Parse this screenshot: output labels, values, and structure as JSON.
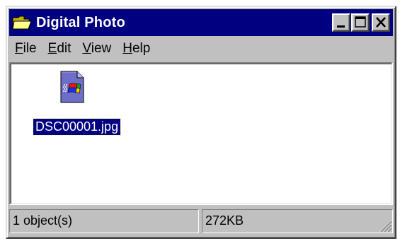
{
  "window": {
    "title": "Digital Photo",
    "title_icon": "folder-open-icon",
    "controls": {
      "minimize_icon": "minimize-icon",
      "maximize_icon": "maximize-icon",
      "close_icon": "close-icon"
    }
  },
  "menu": {
    "items": [
      {
        "label_mnemonic": "F",
        "label_rest": "ile"
      },
      {
        "label_mnemonic": "E",
        "label_rest": "dit"
      },
      {
        "label_mnemonic": "V",
        "label_rest": "iew"
      },
      {
        "label_mnemonic": "H",
        "label_rest": "elp"
      }
    ]
  },
  "files": [
    {
      "name": "DSC00001.jpg",
      "icon": "image-file-icon",
      "selected": true
    }
  ],
  "status": {
    "objects": "1 object(s)",
    "size": "272KB"
  },
  "colors": {
    "title_bar": "#000080",
    "face": "#c0c0c0",
    "selection": "#000080",
    "content_bg": "#ffffff"
  }
}
